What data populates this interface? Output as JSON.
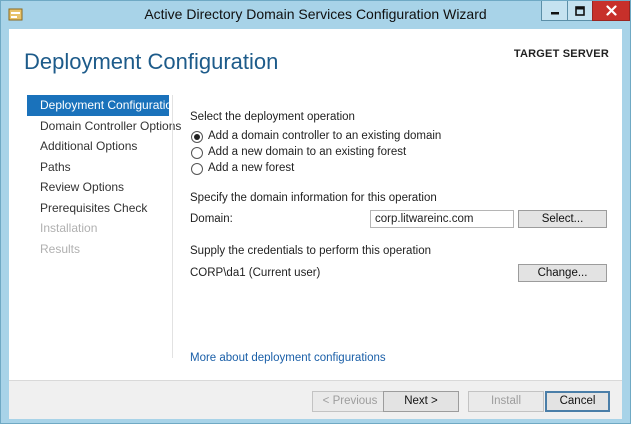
{
  "window": {
    "title": "Active Directory Domain Services Configuration Wizard",
    "controls": [
      "minimize-icon",
      "maximize-icon",
      "close-icon"
    ]
  },
  "header": {
    "page_title": "Deployment Configuration",
    "target_server_label": "TARGET SERVER"
  },
  "nav": {
    "items": [
      {
        "label": "Deployment Configuration",
        "state": "selected"
      },
      {
        "label": "Domain Controller Options",
        "state": "normal"
      },
      {
        "label": "Additional Options",
        "state": "normal"
      },
      {
        "label": "Paths",
        "state": "normal"
      },
      {
        "label": "Review Options",
        "state": "normal"
      },
      {
        "label": "Prerequisites Check",
        "state": "normal"
      },
      {
        "label": "Installation",
        "state": "disabled"
      },
      {
        "label": "Results",
        "state": "disabled"
      }
    ]
  },
  "main": {
    "operation_heading": "Select the deployment operation",
    "options": [
      {
        "label": "Add a domain controller to an existing domain",
        "checked": true
      },
      {
        "label": "Add a new domain to an existing forest",
        "checked": false
      },
      {
        "label": "Add a new forest",
        "checked": false
      }
    ],
    "domain_heading": "Specify the domain information for this operation",
    "domain_label": "Domain:",
    "domain_value": "corp.litwareinc.com",
    "select_button": "Select...",
    "credentials_heading": "Supply the credentials to perform this operation",
    "current_user": "CORP\\da1 (Current user)",
    "change_button": "Change...",
    "more_link": "More about deployment configurations"
  },
  "footer": {
    "previous": "< Previous",
    "next": "Next >",
    "install": "Install",
    "cancel": "Cancel"
  },
  "colors": {
    "title_bar": "#a8d3e8",
    "accent": "#1a72bb",
    "page_title": "#1d5b8a",
    "link": "#1a5fa8",
    "close_button": "#c7302a"
  }
}
